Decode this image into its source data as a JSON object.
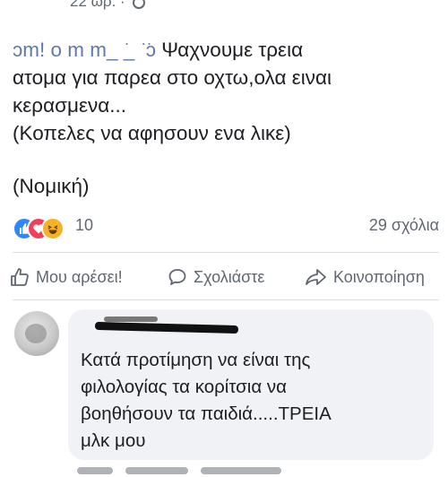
{
  "post": {
    "time": "22 ωρ. · ",
    "tag_blurred": "ɔm! ο  m  m_ ͘_ ͘ ͘ͻ",
    "lines": [
      "Ψαχνουμε τρεια",
      "ατομα για παρεα στο οχτω,ολα ειναι",
      "κερασμενα...",
      "(Κοπελες να αφησουν ενα λικε)"
    ],
    "footer_tag": "(Νομική)"
  },
  "reactions": {
    "icons": [
      "like-icon",
      "love-icon",
      "haha-icon"
    ],
    "count": "10",
    "comments": "29 σχόλια",
    "colors": {
      "like": "#2d88ff",
      "love": "#f33e58",
      "haha": "#f7b125"
    }
  },
  "actions": {
    "like": "Μου αρέσει!",
    "comment": "Σχολιάστε",
    "share": "Κοινοποίηση"
  },
  "comment": {
    "lines": [
      "Κατά προτίμηση να είναι της",
      "φιλολογίας τα κορίτσια να",
      "βοηθήσουν τα παιδιά.....ΤΡΕΙΑ",
      "μλκ μου"
    ]
  }
}
